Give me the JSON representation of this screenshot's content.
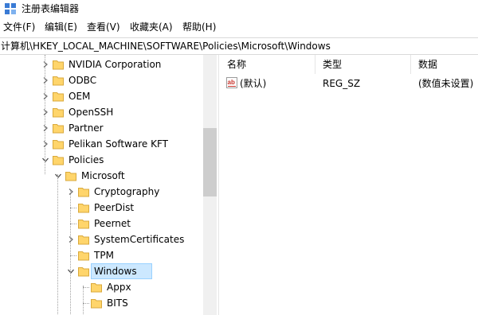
{
  "window": {
    "title": "注册表编辑器"
  },
  "menu": [
    "文件(F)",
    "编辑(E)",
    "查看(V)",
    "收藏夹(A)",
    "帮助(H)"
  ],
  "address": "计算机\\HKEY_LOCAL_MACHINE\\SOFTWARE\\Policies\\Microsoft\\Windows",
  "tree": {
    "items": [
      {
        "label": "NVIDIA Corporation",
        "state": "collapsed"
      },
      {
        "label": "ODBC",
        "state": "collapsed"
      },
      {
        "label": "OEM",
        "state": "collapsed"
      },
      {
        "label": "OpenSSH",
        "state": "collapsed"
      },
      {
        "label": "Partner",
        "state": "collapsed"
      },
      {
        "label": "Pelikan Software KFT",
        "state": "collapsed"
      },
      {
        "label": "Policies",
        "state": "expanded"
      },
      {
        "label": "Microsoft",
        "state": "expanded"
      },
      {
        "label": "Cryptography",
        "state": "collapsed"
      },
      {
        "label": "PeerDist",
        "state": "leaf"
      },
      {
        "label": "Peernet",
        "state": "leaf"
      },
      {
        "label": "SystemCertificates",
        "state": "collapsed"
      },
      {
        "label": "TPM",
        "state": "leaf"
      },
      {
        "label": "Windows",
        "state": "expanded",
        "selected": true
      },
      {
        "label": "Appx",
        "state": "leaf"
      },
      {
        "label": "BITS",
        "state": "leaf"
      }
    ]
  },
  "list": {
    "columns": [
      "名称",
      "类型",
      "数据"
    ],
    "rows": [
      {
        "name": "(默认)",
        "type": "REG_SZ",
        "data": "(数值未设置)",
        "icon": "ab-string-icon"
      }
    ]
  },
  "colors": {
    "selection": "#cce8ff",
    "folder": "#ffd56b",
    "string_icon": "#c8332b"
  }
}
